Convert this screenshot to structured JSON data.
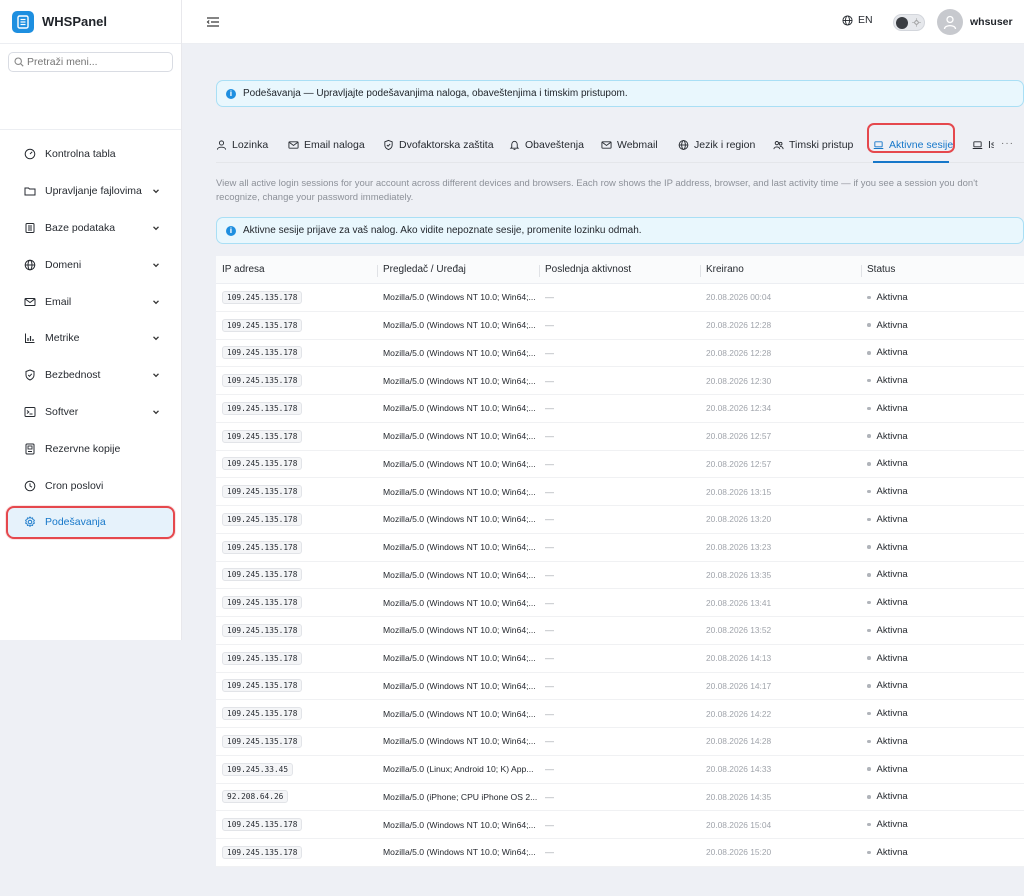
{
  "app": {
    "name": "WHSPanel"
  },
  "sidebar": {
    "search_placeholder": "Pretraži meni...",
    "items": [
      {
        "label": "Kontrolna tabla",
        "icon": "dashboard-icon",
        "expandable": false
      },
      {
        "label": "Upravljanje fajlovima",
        "icon": "folder-icon",
        "expandable": true
      },
      {
        "label": "Baze podataka",
        "icon": "database-icon",
        "expandable": true
      },
      {
        "label": "Domeni",
        "icon": "globe-icon",
        "expandable": true
      },
      {
        "label": "Email",
        "icon": "mail-icon",
        "expandable": true
      },
      {
        "label": "Metrike",
        "icon": "chart-icon",
        "expandable": true
      },
      {
        "label": "Bezbednost",
        "icon": "shield-icon",
        "expandable": true
      },
      {
        "label": "Softver",
        "icon": "terminal-icon",
        "expandable": true
      },
      {
        "label": "Rezervne kopije",
        "icon": "backup-icon",
        "expandable": false
      },
      {
        "label": "Cron poslovi",
        "icon": "clock-icon",
        "expandable": false
      },
      {
        "label": "Podešavanja",
        "icon": "gear-icon",
        "expandable": false,
        "active": true
      }
    ]
  },
  "header": {
    "language": "EN",
    "username": "whsuser"
  },
  "page": {
    "alert_top": "Podešavanja — Upravljajte podešavanjima naloga, obaveštenjima i timskim pristupom.",
    "tabs": [
      {
        "label": "Lozinka",
        "icon": "user-icon"
      },
      {
        "label": "Email naloga",
        "icon": "mail-icon"
      },
      {
        "label": "Dvofaktorska zaštita",
        "icon": "shield-check-icon"
      },
      {
        "label": "Obaveštenja",
        "icon": "bell-icon"
      },
      {
        "label": "Webmail",
        "icon": "mail-icon"
      },
      {
        "label": "Jezik i region",
        "icon": "globe-icon"
      },
      {
        "label": "Timski pristup",
        "icon": "team-icon"
      },
      {
        "label": "Aktivne sesije",
        "icon": "laptop-icon",
        "active": true
      },
      {
        "label": "Is",
        "icon": "laptop-icon"
      }
    ],
    "tabs_more": "···",
    "description": "View all active login sessions for your account across different devices and browsers. Each row shows the IP address, browser, and last activity time — if you see a session you don't recognize, change your password immediately.",
    "alert_sessions": "Aktivne sesije prijave za vaš nalog. Ako vidite nepoznate sesije, promenite lozinku odmah."
  },
  "table": {
    "columns": [
      "IP adresa",
      "Pregledač / Uređaj",
      "Poslednja aktivnost",
      "Kreirano",
      "Status"
    ],
    "rows": [
      {
        "ip": "109.245.135.178",
        "agent": "Mozilla/5.0 (Windows NT 10.0; Win64;...",
        "last": "—",
        "created": "20.08.2026 00:04",
        "status": "Aktivna"
      },
      {
        "ip": "109.245.135.178",
        "agent": "Mozilla/5.0 (Windows NT 10.0; Win64;...",
        "last": "—",
        "created": "20.08.2026 12:28",
        "status": "Aktivna"
      },
      {
        "ip": "109.245.135.178",
        "agent": "Mozilla/5.0 (Windows NT 10.0; Win64;...",
        "last": "—",
        "created": "20.08.2026 12:28",
        "status": "Aktivna"
      },
      {
        "ip": "109.245.135.178",
        "agent": "Mozilla/5.0 (Windows NT 10.0; Win64;...",
        "last": "—",
        "created": "20.08.2026 12:30",
        "status": "Aktivna"
      },
      {
        "ip": "109.245.135.178",
        "agent": "Mozilla/5.0 (Windows NT 10.0; Win64;...",
        "last": "—",
        "created": "20.08.2026 12:34",
        "status": "Aktivna"
      },
      {
        "ip": "109.245.135.178",
        "agent": "Mozilla/5.0 (Windows NT 10.0; Win64;...",
        "last": "—",
        "created": "20.08.2026 12:57",
        "status": "Aktivna"
      },
      {
        "ip": "109.245.135.178",
        "agent": "Mozilla/5.0 (Windows NT 10.0; Win64;...",
        "last": "—",
        "created": "20.08.2026 12:57",
        "status": "Aktivna"
      },
      {
        "ip": "109.245.135.178",
        "agent": "Mozilla/5.0 (Windows NT 10.0; Win64;...",
        "last": "—",
        "created": "20.08.2026 13:15",
        "status": "Aktivna"
      },
      {
        "ip": "109.245.135.178",
        "agent": "Mozilla/5.0 (Windows NT 10.0; Win64;...",
        "last": "—",
        "created": "20.08.2026 13:20",
        "status": "Aktivna"
      },
      {
        "ip": "109.245.135.178",
        "agent": "Mozilla/5.0 (Windows NT 10.0; Win64;...",
        "last": "—",
        "created": "20.08.2026 13:23",
        "status": "Aktivna"
      },
      {
        "ip": "109.245.135.178",
        "agent": "Mozilla/5.0 (Windows NT 10.0; Win64;...",
        "last": "—",
        "created": "20.08.2026 13:35",
        "status": "Aktivna"
      },
      {
        "ip": "109.245.135.178",
        "agent": "Mozilla/5.0 (Windows NT 10.0; Win64;...",
        "last": "—",
        "created": "20.08.2026 13:41",
        "status": "Aktivna"
      },
      {
        "ip": "109.245.135.178",
        "agent": "Mozilla/5.0 (Windows NT 10.0; Win64;...",
        "last": "—",
        "created": "20.08.2026 13:52",
        "status": "Aktivna"
      },
      {
        "ip": "109.245.135.178",
        "agent": "Mozilla/5.0 (Windows NT 10.0; Win64;...",
        "last": "—",
        "created": "20.08.2026 14:13",
        "status": "Aktivna"
      },
      {
        "ip": "109.245.135.178",
        "agent": "Mozilla/5.0 (Windows NT 10.0; Win64;...",
        "last": "—",
        "created": "20.08.2026 14:17",
        "status": "Aktivna"
      },
      {
        "ip": "109.245.135.178",
        "agent": "Mozilla/5.0 (Windows NT 10.0; Win64;...",
        "last": "—",
        "created": "20.08.2026 14:22",
        "status": "Aktivna"
      },
      {
        "ip": "109.245.135.178",
        "agent": "Mozilla/5.0 (Windows NT 10.0; Win64;...",
        "last": "—",
        "created": "20.08.2026 14:28",
        "status": "Aktivna"
      },
      {
        "ip": "109.245.33.45",
        "agent": "Mozilla/5.0 (Linux; Android 10; K) App...",
        "last": "—",
        "created": "20.08.2026 14:33",
        "status": "Aktivna"
      },
      {
        "ip": "92.208.64.26",
        "agent": "Mozilla/5.0 (iPhone; CPU iPhone OS 2...",
        "last": "—",
        "created": "20.08.2026 14:35",
        "status": "Aktivna"
      },
      {
        "ip": "109.245.135.178",
        "agent": "Mozilla/5.0 (Windows NT 10.0; Win64;...",
        "last": "—",
        "created": "20.08.2026 15:04",
        "status": "Aktivna"
      },
      {
        "ip": "109.245.135.178",
        "agent": "Mozilla/5.0 (Windows NT 10.0; Win64;...",
        "last": "—",
        "created": "20.08.2026 15:20",
        "status": "Aktivna"
      }
    ]
  },
  "colors": {
    "accent": "#1677c9",
    "brand": "#1e8fe0",
    "highlight": "#e5484d",
    "alert_bg": "#e9f7fd"
  }
}
